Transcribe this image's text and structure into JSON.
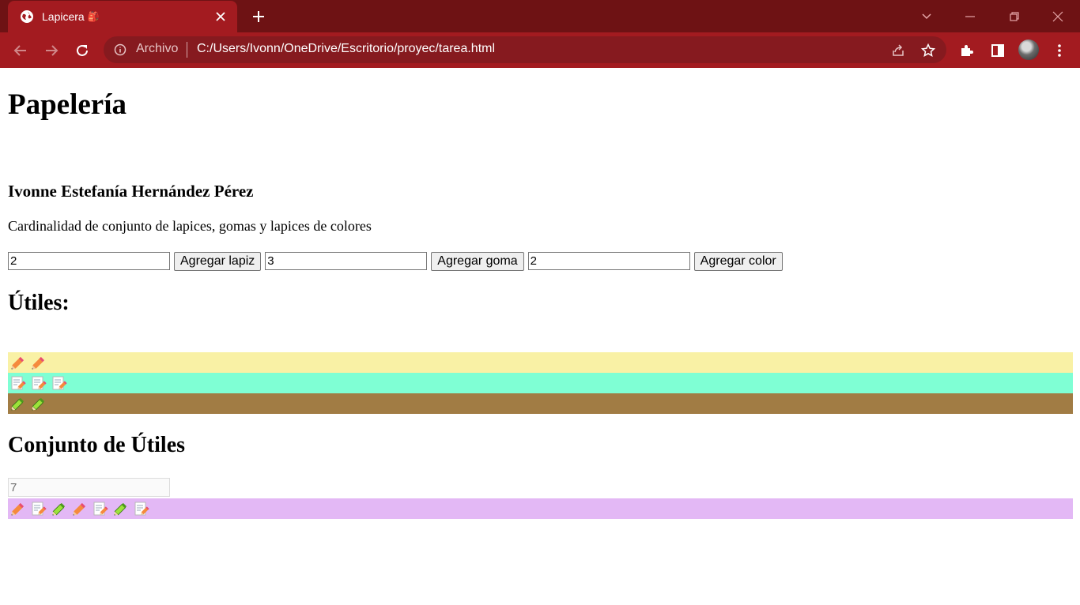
{
  "browser": {
    "tab_title": "Lapicera",
    "tab_emoji": "🎒",
    "address_scheme": "Archivo",
    "address_url": "C:/Users/Ivonn/OneDrive/Escritorio/proyec/tarea.html",
    "theme_color": "#a31b20"
  },
  "page": {
    "title": "Papelería",
    "author": "Ivonne Estefanía Hernández Pérez",
    "description": "Cardinalidad de conjunto de lapices, gomas y lapices de colores",
    "inputs": {
      "lapiz_value": "2",
      "goma_value": "3",
      "color_value": "2"
    },
    "buttons": {
      "agregar_lapiz": "Agregar lapiz",
      "agregar_goma": "Agregar goma",
      "agregar_color": "Agregar color"
    },
    "utiles_heading": "Útiles:",
    "rows": {
      "lapiz": {
        "count": 2,
        "icon": "pencil-icon",
        "color": "#f9f1a5"
      },
      "goma": {
        "count": 3,
        "icon": "eraser-memo-icon",
        "color": "#7fffd4"
      },
      "color": {
        "count": 2,
        "icon": "color-pencil-icon",
        "color": "#a17c44"
      }
    },
    "conjunto_heading": "Conjunto de Útiles",
    "total_value": "7",
    "conjunto_row": {
      "color": "#e3b8f5",
      "items": [
        "pencil-icon",
        "eraser-memo-icon",
        "color-pencil-icon",
        "pencil-icon",
        "eraser-memo-icon",
        "color-pencil-icon",
        "eraser-memo-icon"
      ]
    }
  }
}
